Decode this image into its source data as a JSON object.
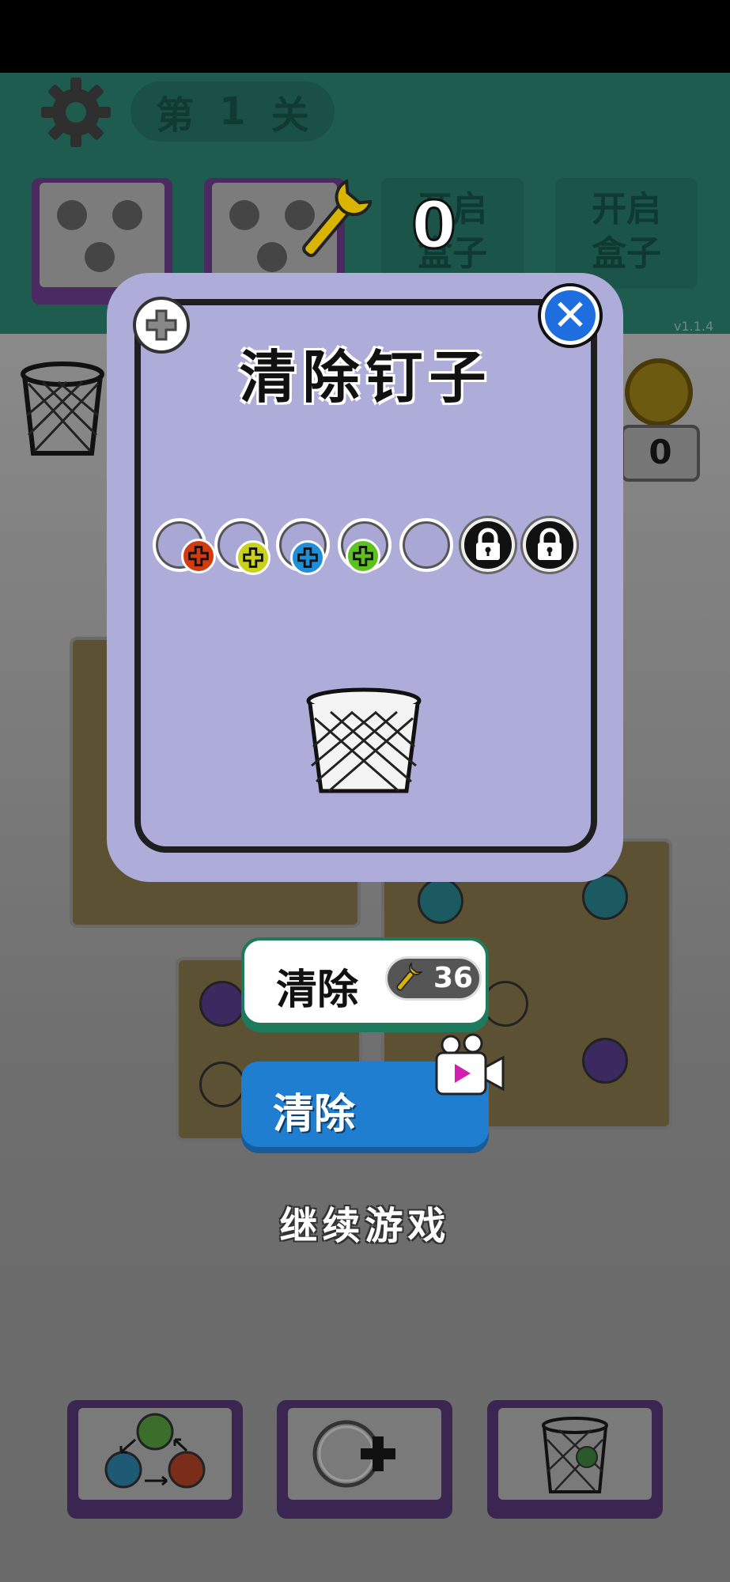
{
  "header": {
    "level_prefix": "第",
    "level_number": "1",
    "level_suffix": "关",
    "wrench_count": "0",
    "open_box_slots": [
      {
        "label_line1": "开启",
        "label_line2": "盒子"
      },
      {
        "label_line1": "开启",
        "label_line2": "盒子"
      }
    ],
    "version": "v1.1.4"
  },
  "background": {
    "side_counter": "0"
  },
  "dialog": {
    "title": "清除钉子",
    "nail_slots": [
      {
        "state": "filled",
        "color": "#d23a10"
      },
      {
        "state": "filled",
        "color": "#c9d21a"
      },
      {
        "state": "filled",
        "color": "#1e8ed8"
      },
      {
        "state": "filled",
        "color": "#5ec21e"
      },
      {
        "state": "empty"
      },
      {
        "state": "locked",
        "icon": "lock-icon"
      },
      {
        "state": "locked",
        "icon": "lock-icon"
      }
    ]
  },
  "actions": {
    "clear_with_wrench_label": "清除",
    "clear_cost": "36",
    "clear_with_video_label": "清除",
    "continue_label": "继续游戏"
  },
  "tools": [
    {
      "icon": "swap-screws-icon"
    },
    {
      "icon": "add-slot-icon"
    },
    {
      "icon": "trash-bin-icon"
    }
  ],
  "colors": {
    "dialog_bg": "#aeacd9",
    "primary_blue": "#1f7ed0",
    "accent_green": "#1e7a5c"
  }
}
